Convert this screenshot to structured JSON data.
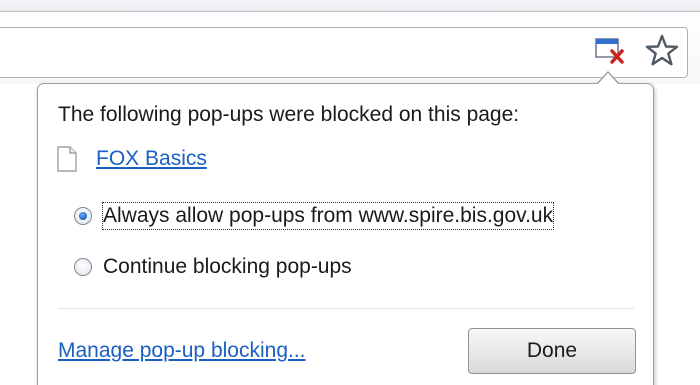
{
  "toolbar": {
    "popup_blocked_icon": "popup-blocked-icon",
    "bookmark_icon": "star-icon"
  },
  "bubble": {
    "title": "The following pop-ups were blocked on this page:",
    "blocked_popups": [
      {
        "label": "FOX Basics",
        "icon": "page-icon"
      }
    ],
    "options": [
      {
        "label": "Always allow pop-ups from www.spire.bis.gov.uk",
        "selected": true
      },
      {
        "label": "Continue blocking pop-ups",
        "selected": false
      }
    ],
    "manage_link": "Manage pop-up blocking...",
    "done_label": "Done"
  },
  "colors": {
    "link": "#1a5fc2",
    "blocked_x": "#cc1f1f",
    "icon_blue": "#2f6fd0"
  }
}
